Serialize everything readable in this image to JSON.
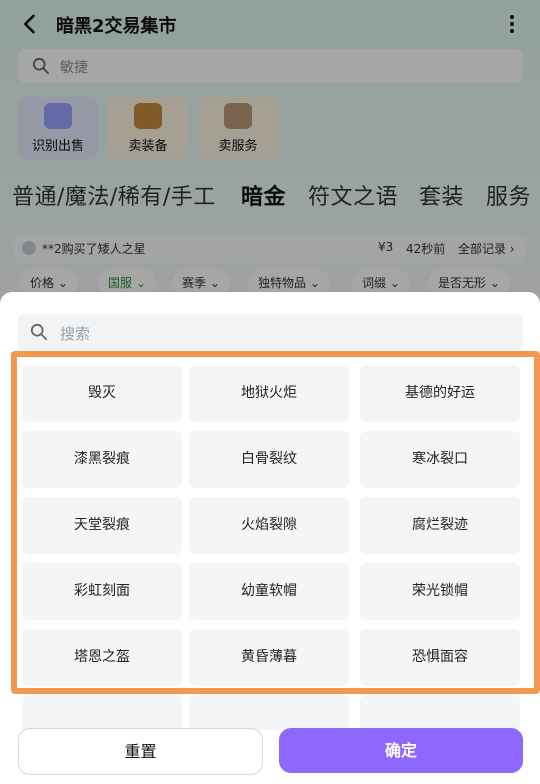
{
  "header": {
    "title": "暗黑2交易集市"
  },
  "page_search": {
    "placeholder": "敏捷"
  },
  "tiles": [
    {
      "label": "识别出售"
    },
    {
      "label": "卖装备"
    },
    {
      "label": "卖服务"
    }
  ],
  "categories": [
    "普通/魔法/稀有/手工",
    "暗金",
    "符文之语",
    "套装",
    "服务"
  ],
  "activity": {
    "text": "**2购买了矮人之星",
    "price": "¥3",
    "time": "42秒前",
    "link": "全部记录 ›"
  },
  "filters": [
    "价格 ⌄",
    "国服 ⌄",
    "赛季 ⌄",
    "独特物品 ⌄",
    "词缀 ⌄",
    "是否无形 ⌄"
  ],
  "sheet": {
    "search_placeholder": "搜索",
    "items": [
      "毁灭",
      "地狱火炬",
      "基德的好运",
      "漆黑裂痕",
      "白骨裂纹",
      "寒冰裂口",
      "天堂裂痕",
      "火焰裂隙",
      "腐烂裂迹",
      "彩虹刻面",
      "幼童软帽",
      "荣光锁帽",
      "塔恩之盔",
      "黄昏薄暮",
      "恐惧面容"
    ],
    "buttons": {
      "reset": "重置",
      "confirm": "确定"
    }
  },
  "colors": {
    "accent": "#8d67ff",
    "highlight": "#f19a4f"
  }
}
